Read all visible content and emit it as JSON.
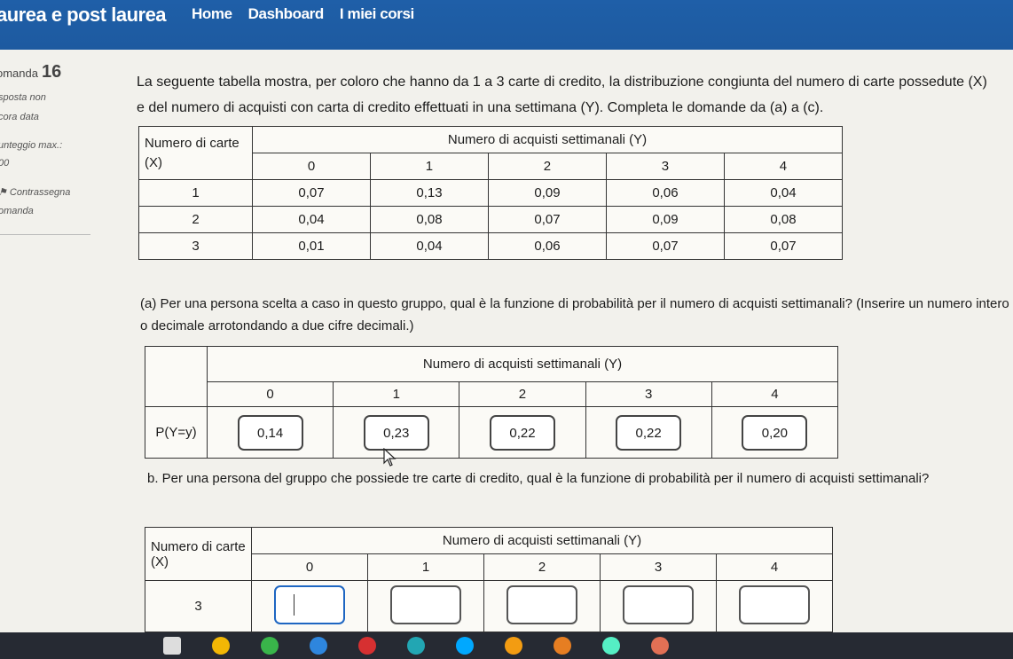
{
  "nav": {
    "brand": "aurea e post laurea",
    "links": [
      "Home",
      "Dashboard",
      "I miei corsi"
    ]
  },
  "sidebar": {
    "question_label": "omanda",
    "question_number": "16",
    "status_1": "sposta non",
    "status_2": "cora data",
    "points_1": "unteggio max.:",
    "points_2": "00",
    "flag_1": "Contrassegna",
    "flag_2": "omanda"
  },
  "question": {
    "intro": "La seguente tabella mostra, per coloro che hanno da 1 a 3 carte di credito, la distribuzione congiunta del numero di carte possedute (X) e del numero di acquisti con carta di credito effettuati in una settimana (Y). Completa le domande da  (a) a (c).",
    "joint_table": {
      "row_header": "Numero di carte (X)",
      "col_header": "Numero di acquisti settimanali (Y)",
      "columns": [
        "0",
        "1",
        "2",
        "3",
        "4"
      ],
      "rows": [
        {
          "label": "1",
          "values": [
            "0,07",
            "0,13",
            "0,09",
            "0,06",
            "0,04"
          ]
        },
        {
          "label": "2",
          "values": [
            "0,04",
            "0,08",
            "0,07",
            "0,09",
            "0,08"
          ]
        },
        {
          "label": "3",
          "values": [
            "0,01",
            "0,04",
            "0,06",
            "0,07",
            "0,07"
          ]
        }
      ]
    },
    "part_a": "(a) Per una persona scelta a caso in questo gruppo, qual è la funzione di probabilità per il numero di acquisti settimanali? (Inserire un numero intero o decimale arrotondando a due cifre decimali.)",
    "table_a": {
      "col_header": "Numero di acquisti settimanali (Y)",
      "columns": [
        "0",
        "1",
        "2",
        "3",
        "4"
      ],
      "row_label": "P(Y=y)",
      "answers": [
        "0,14",
        "0,23",
        "0,22",
        "0,22",
        "0,20"
      ]
    },
    "part_b": "b. Per una persona del gruppo che possiede tre carte di credito, qual è la funzione di probabilità per il numero di acquisti settimanali?",
    "table_b": {
      "row_header": "Numero di carte (X)",
      "col_header": "Numero di acquisti settimanali (Y)",
      "columns": [
        "0",
        "1",
        "2",
        "3",
        "4"
      ],
      "row_label": "3",
      "answers": [
        "",
        "",
        "",
        "",
        ""
      ]
    }
  },
  "taskbar": {
    "icons": [
      "files-icon",
      "chrome-icon",
      "stack-icon",
      "image-icon",
      "code-icon",
      "chat-icon",
      "browser-icon",
      "globe-icon",
      "globe-icon-2",
      "settings-icon",
      "globe-icon-3"
    ],
    "colors": [
      "#dddddd",
      "#f2b705",
      "#39b54a",
      "#2e86de",
      "#d63031",
      "#22a6b3",
      "#00a8ff",
      "#f39c12",
      "#e67e22",
      "#55efc4",
      "#e17055"
    ]
  }
}
